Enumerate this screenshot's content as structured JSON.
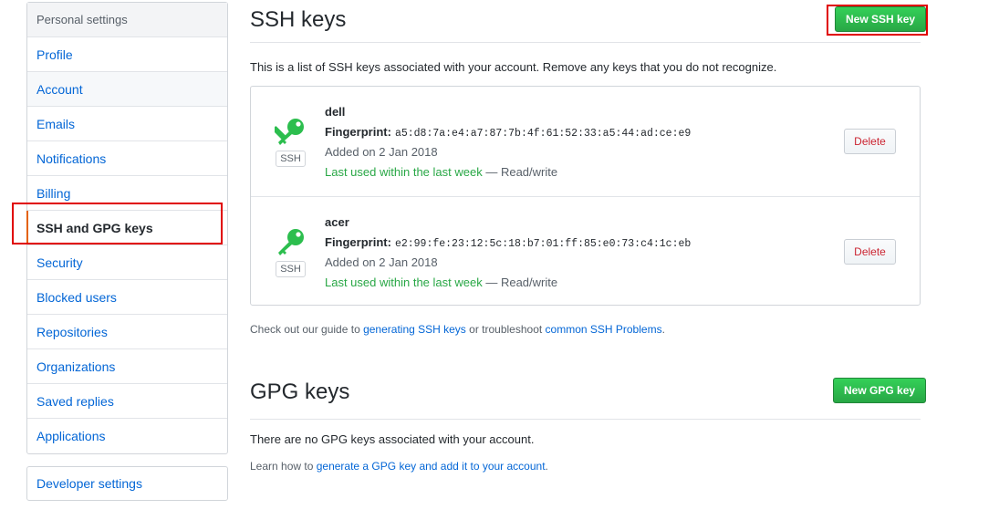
{
  "sidebar": {
    "header": "Personal settings",
    "items": [
      {
        "label": "Profile"
      },
      {
        "label": "Account"
      },
      {
        "label": "Emails"
      },
      {
        "label": "Notifications"
      },
      {
        "label": "Billing"
      },
      {
        "label": "SSH and GPG keys"
      },
      {
        "label": "Security"
      },
      {
        "label": "Blocked users"
      },
      {
        "label": "Repositories"
      },
      {
        "label": "Organizations"
      },
      {
        "label": "Saved replies"
      },
      {
        "label": "Applications"
      }
    ],
    "selected_index": 5,
    "developer_settings": "Developer settings"
  },
  "ssh": {
    "title": "SSH keys",
    "new_button": "New SSH key",
    "description": "This is a list of SSH keys associated with your account. Remove any keys that you do not recognize.",
    "keys": [
      {
        "name": "dell",
        "fingerprint_label": "Fingerprint:",
        "fingerprint": "a5:d8:7a:e4:a7:87:7b:4f:61:52:33:a5:44:ad:ce:e9",
        "added": "Added on 2 Jan 2018",
        "last_used": "Last used within the last week",
        "access": "— Read/write",
        "badge": "SSH",
        "delete_label": "Delete"
      },
      {
        "name": "acer",
        "fingerprint_label": "Fingerprint:",
        "fingerprint": "e2:99:fe:23:12:5c:18:b7:01:ff:85:e0:73:c4:1c:eb",
        "added": "Added on 2 Jan 2018",
        "last_used": "Last used within the last week",
        "access": "— Read/write",
        "badge": "SSH",
        "delete_label": "Delete"
      }
    ],
    "guide": {
      "prefix": "Check out our guide to ",
      "link1": "generating SSH keys",
      "middle": " or troubleshoot ",
      "link2": "common SSH Problems",
      "suffix": "."
    }
  },
  "gpg": {
    "title": "GPG keys",
    "new_button": "New GPG key",
    "empty": "There are no GPG keys associated with your account.",
    "learn": {
      "prefix": "Learn how to ",
      "link": "generate a GPG key and add it to your account",
      "suffix": "."
    }
  },
  "colors": {
    "link": "#0366d6",
    "green": "#28a745",
    "key_icon": "#2cbe4e",
    "danger": "#cb2431",
    "highlight": "#e00000",
    "selected_bar": "#e36209"
  },
  "icons": {
    "key": "key-icon"
  }
}
